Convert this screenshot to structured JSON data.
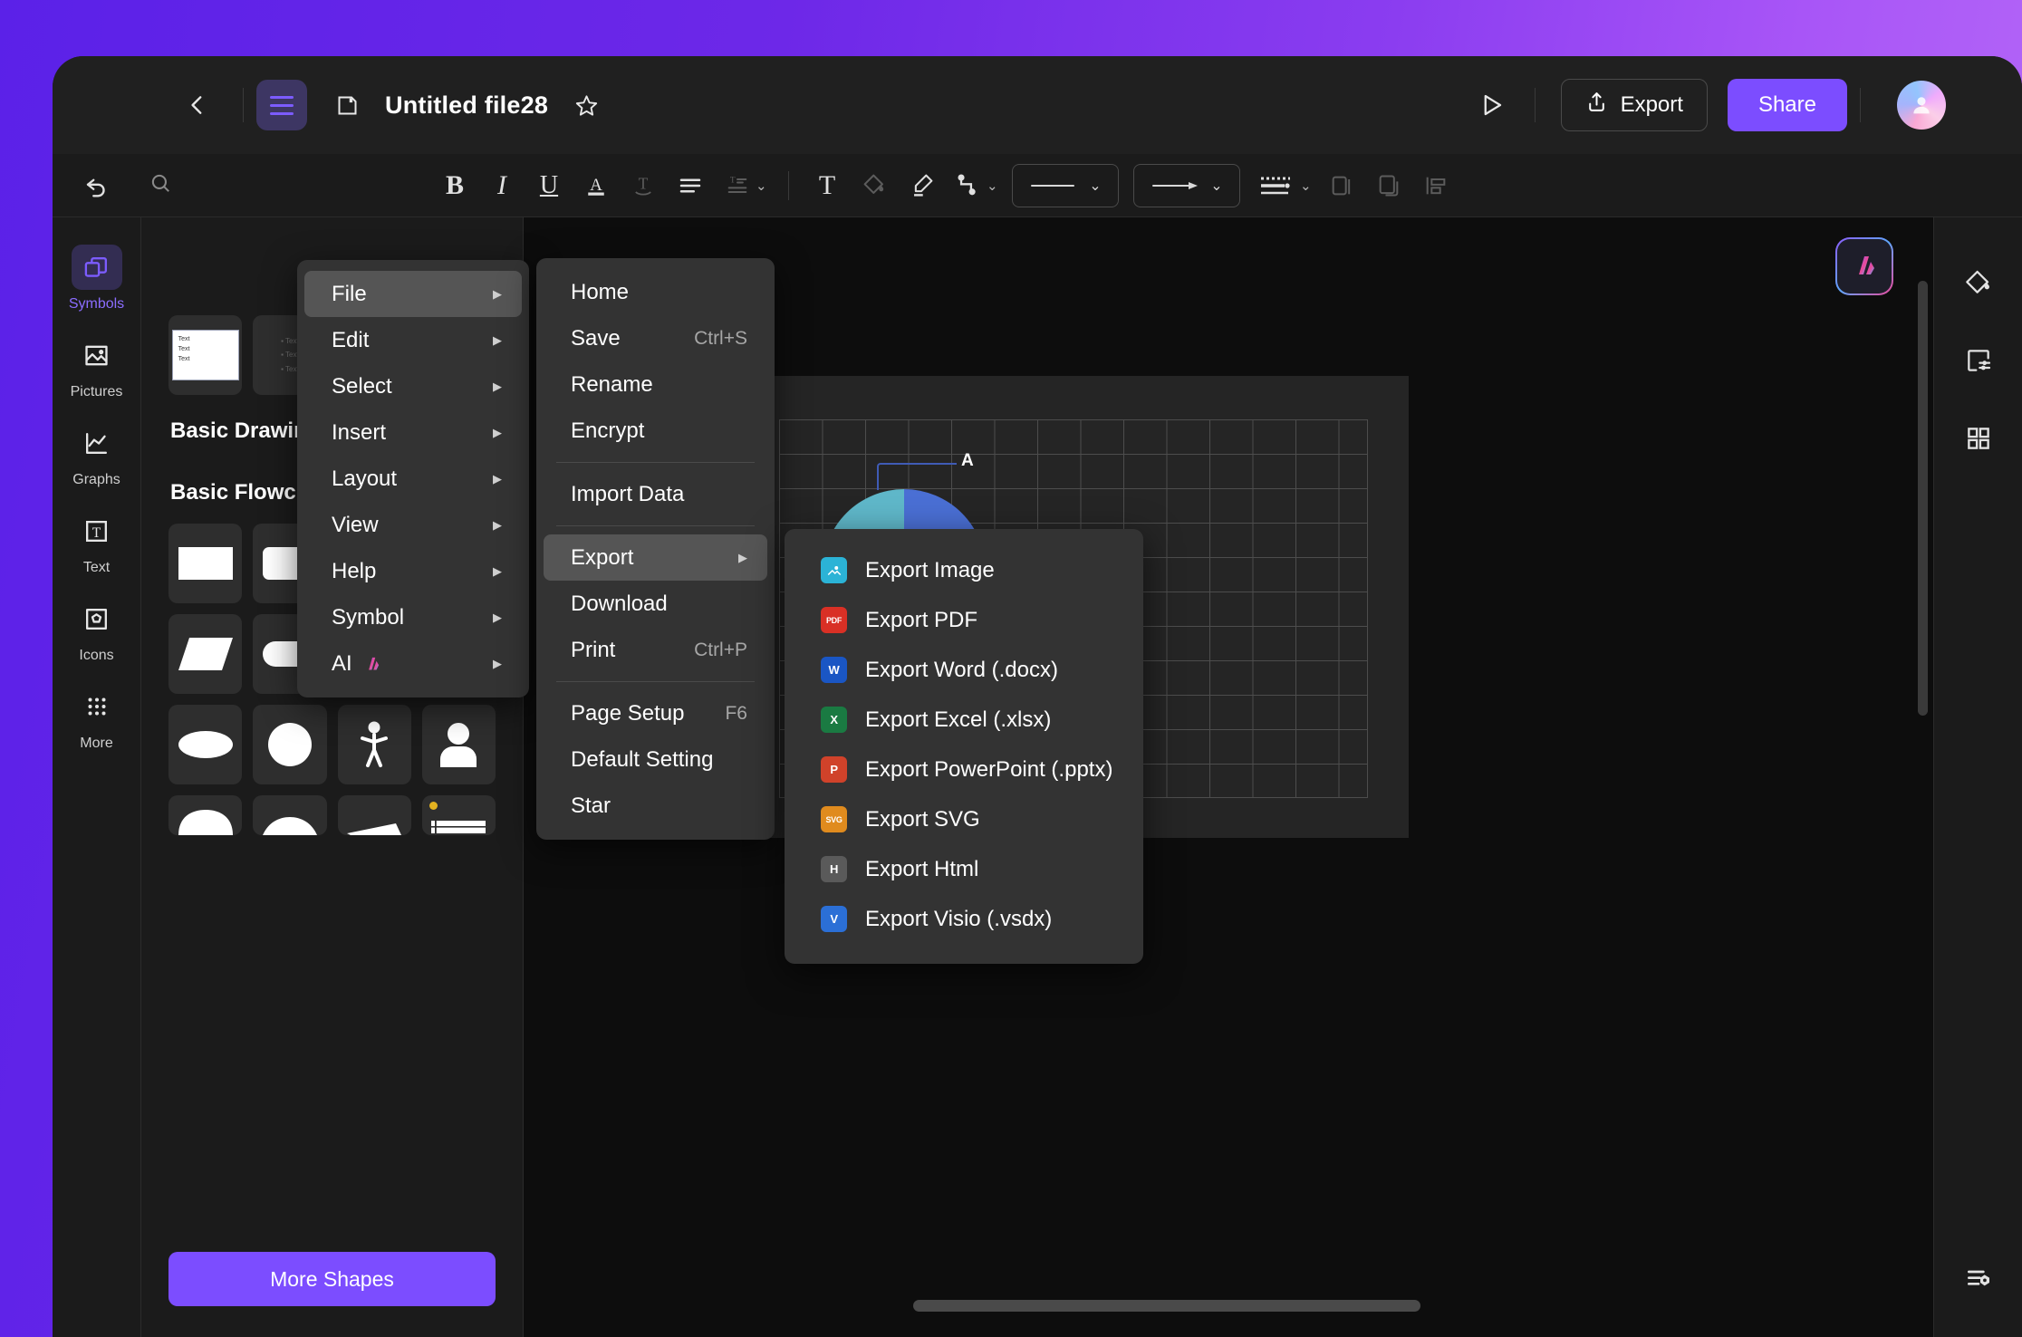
{
  "header": {
    "back_icon": "chevron-left-icon",
    "menu_icon": "hamburger-icon",
    "save_icon": "floppy-disk-icon",
    "title": "Untitled file28",
    "star_icon": "star-outline-icon",
    "play_icon": "play-triangle-icon",
    "export_label": "Export",
    "export_icon": "share-upload-icon",
    "share_label": "Share",
    "avatar_icon": "user-avatar",
    "accent_color": "#7c4dff"
  },
  "toolbar": {
    "undo_icon": "undo-arrow-icon",
    "search_icon": "search-icon",
    "items": [
      {
        "name": "bold",
        "glyph": "B",
        "dim": false
      },
      {
        "name": "italic",
        "glyph": "I",
        "dim": false
      },
      {
        "name": "underline",
        "glyph": "U",
        "dim": false
      },
      {
        "name": "font-color",
        "glyph": "A",
        "dim": false
      },
      {
        "name": "text-effect",
        "glyph": "T",
        "dim": true
      },
      {
        "name": "align",
        "glyph": "align",
        "dim": false
      },
      {
        "name": "line-spacing",
        "glyph": "spacing",
        "dim": true
      },
      {
        "name": "text-box",
        "glyph": "T",
        "dim": false
      },
      {
        "name": "fill-color",
        "glyph": "bucket",
        "dim": true
      },
      {
        "name": "line-brush",
        "glyph": "brush",
        "dim": false
      },
      {
        "name": "connector",
        "glyph": "connector",
        "dim": false
      }
    ],
    "line_style_label": "line-style",
    "arrow_style_label": "arrow-style",
    "dash_style_label": "dash-style",
    "copy_icon": "copy-icon",
    "duplicate_icon": "duplicate-icon",
    "align_objects_icon": "align-objects-icon"
  },
  "sidebar": {
    "items": [
      {
        "label": "Symbols",
        "icon": "symbols-icon",
        "active": true
      },
      {
        "label": "Pictures",
        "icon": "pictures-icon",
        "active": false
      },
      {
        "label": "Graphs",
        "icon": "graphs-icon",
        "active": false
      },
      {
        "label": "Text",
        "icon": "text-icon",
        "active": false
      },
      {
        "label": "Icons",
        "icon": "icons-icon",
        "active": false
      },
      {
        "label": "More",
        "icon": "more-dots-icon",
        "active": false
      }
    ]
  },
  "shapes_panel": {
    "text_thumb_lines": [
      "Text",
      "Text",
      "Text"
    ],
    "list_thumb_lines": [
      "Text",
      "Text",
      "Text"
    ],
    "section_basic_drawing": "Basic Drawing Shape",
    "section_basic_flowchart": "Basic Flowchart Sha...",
    "collapse_icon": "chevron-up-icon",
    "more_shapes_label": "More Shapes",
    "flowchart_shapes": [
      {
        "name": "rectangle",
        "badge": false
      },
      {
        "name": "rounded-rectangle",
        "badge": false
      },
      {
        "name": "diamond",
        "badge": false
      },
      {
        "name": "document",
        "badge": false
      },
      {
        "name": "parallelogram",
        "badge": false
      },
      {
        "name": "stadium",
        "badge": false
      },
      {
        "name": "predefined-process",
        "badge": true
      },
      {
        "name": "alternate-process",
        "badge": true
      },
      {
        "name": "ellipse",
        "badge": false
      },
      {
        "name": "circle",
        "badge": false
      },
      {
        "name": "stick-figure",
        "badge": false
      },
      {
        "name": "person",
        "badge": false
      },
      {
        "name": "half-round",
        "badge": false
      },
      {
        "name": "curved-band",
        "badge": false
      },
      {
        "name": "slanted-card",
        "badge": false
      },
      {
        "name": "table-header",
        "badge": true
      }
    ]
  },
  "canvas": {
    "ai_button_icon": "ai-sparkle-icon",
    "pie_label": "A",
    "h_scrollbar": "horizontal-scrollbar",
    "v_scrollbar": "vertical-scrollbar"
  },
  "right_rail": {
    "items": [
      {
        "name": "fill-style-icon"
      },
      {
        "name": "page-settings-icon"
      },
      {
        "name": "grid-apps-icon"
      }
    ],
    "bottom_item": {
      "name": "list-settings-icon"
    }
  },
  "main_menu": {
    "items": [
      {
        "label": "File",
        "selected": true,
        "arrow": true,
        "ai": false
      },
      {
        "label": "Edit",
        "selected": false,
        "arrow": true,
        "ai": false
      },
      {
        "label": "Select",
        "selected": false,
        "arrow": true,
        "ai": false
      },
      {
        "label": "Insert",
        "selected": false,
        "arrow": true,
        "ai": false
      },
      {
        "label": "Layout",
        "selected": false,
        "arrow": true,
        "ai": false
      },
      {
        "label": "View",
        "selected": false,
        "arrow": true,
        "ai": false
      },
      {
        "label": "Help",
        "selected": false,
        "arrow": true,
        "ai": false
      },
      {
        "label": "Symbol",
        "selected": false,
        "arrow": true,
        "ai": false
      },
      {
        "label": "AI",
        "selected": false,
        "arrow": true,
        "ai": true
      }
    ]
  },
  "file_menu": {
    "items": [
      {
        "label": "Home",
        "shortcut": "",
        "arrow": false,
        "selected": false,
        "sep_after": false
      },
      {
        "label": "Save",
        "shortcut": "Ctrl+S",
        "arrow": false,
        "selected": false,
        "sep_after": false
      },
      {
        "label": "Rename",
        "shortcut": "",
        "arrow": false,
        "selected": false,
        "sep_after": false
      },
      {
        "label": "Encrypt",
        "shortcut": "",
        "arrow": false,
        "selected": false,
        "sep_after": true
      },
      {
        "label": "Import Data",
        "shortcut": "",
        "arrow": false,
        "selected": false,
        "sep_after": true
      },
      {
        "label": "Export",
        "shortcut": "",
        "arrow": true,
        "selected": true,
        "sep_after": false
      },
      {
        "label": "Download",
        "shortcut": "",
        "arrow": false,
        "selected": false,
        "sep_after": false
      },
      {
        "label": "Print",
        "shortcut": "Ctrl+P",
        "arrow": false,
        "selected": false,
        "sep_after": true
      },
      {
        "label": "Page Setup",
        "shortcut": "F6",
        "arrow": false,
        "selected": false,
        "sep_after": false
      },
      {
        "label": "Default Setting",
        "shortcut": "",
        "arrow": false,
        "selected": false,
        "sep_after": false
      },
      {
        "label": "Star",
        "shortcut": "",
        "arrow": false,
        "selected": false,
        "sep_after": false
      }
    ]
  },
  "export_menu": {
    "items": [
      {
        "label": "Export Image",
        "icon": "image-file-icon",
        "badge": "",
        "color": "#2bb3d6"
      },
      {
        "label": "Export PDF",
        "icon": "pdf-file-icon",
        "badge": "PDF",
        "color": "#d93025"
      },
      {
        "label": "Export Word (.docx)",
        "icon": "word-file-icon",
        "badge": "W",
        "color": "#1a56c4"
      },
      {
        "label": "Export Excel (.xlsx)",
        "icon": "excel-file-icon",
        "badge": "X",
        "color": "#1a7a42"
      },
      {
        "label": "Export PowerPoint (.pptx)",
        "icon": "powerpoint-file-icon",
        "badge": "P",
        "color": "#d0422a"
      },
      {
        "label": "Export SVG",
        "icon": "svg-file-icon",
        "badge": "SVG",
        "color": "#e08b1e"
      },
      {
        "label": "Export Html",
        "icon": "html-file-icon",
        "badge": "H",
        "color": "#5a5a5a"
      },
      {
        "label": "Export Visio (.vsdx)",
        "icon": "visio-file-icon",
        "badge": "V",
        "color": "#2b6fd6"
      }
    ]
  }
}
